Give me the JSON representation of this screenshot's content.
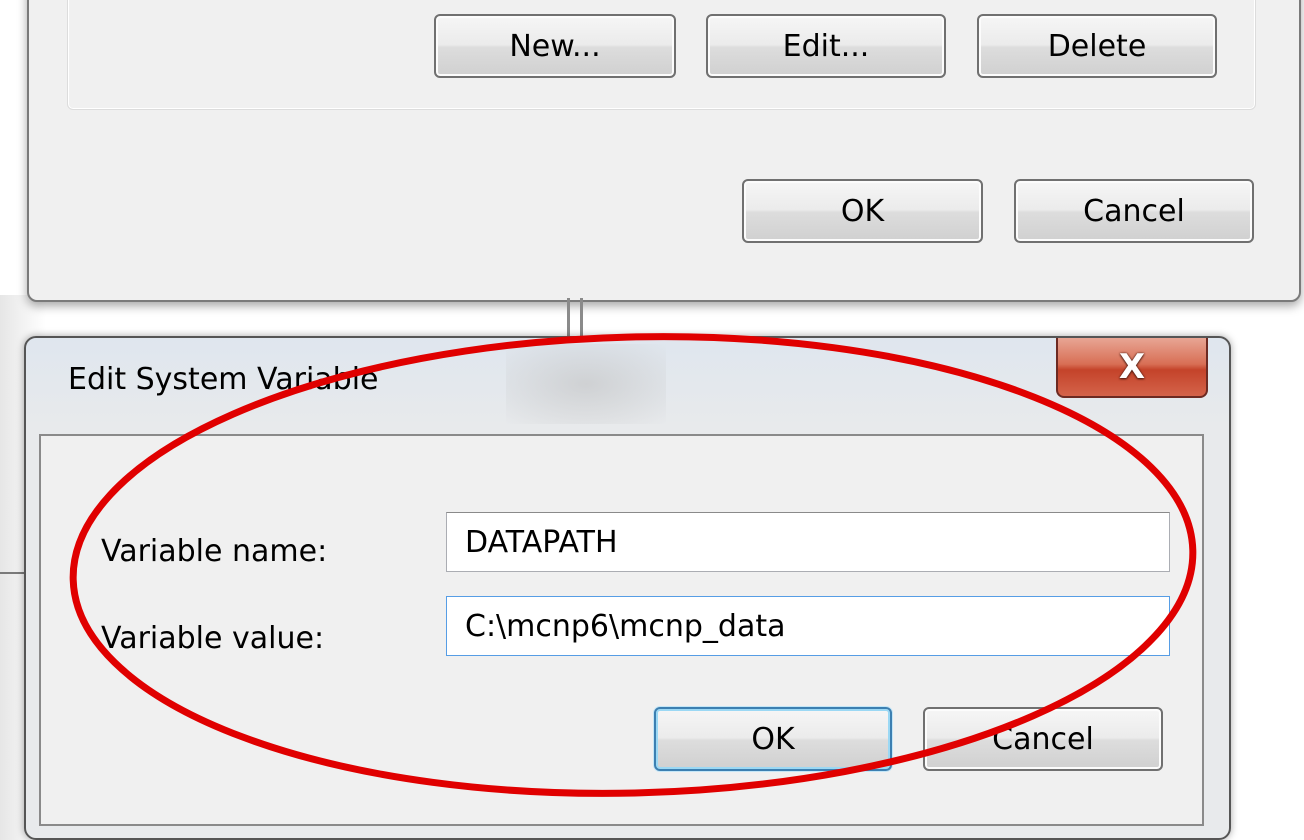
{
  "background_window": {
    "buttons": {
      "new_label": "New...",
      "edit_label": "Edit...",
      "delete_label": "Delete",
      "ok_label": "OK",
      "cancel_label": "Cancel"
    }
  },
  "dialog": {
    "title": "Edit System Variable",
    "close_label": "X",
    "fields": {
      "name_label": "Variable name:",
      "name_value": "DATAPATH",
      "value_label": "Variable value:",
      "value_value": "C:\\mcnp6\\mcnp_data"
    },
    "buttons": {
      "ok_label": "OK",
      "cancel_label": "Cancel"
    }
  },
  "annotation": {
    "shape": "ellipse",
    "color": "#e00000"
  },
  "colors": {
    "close_button": "#c4432a",
    "focus_border": "#569de5",
    "default_button_border": "#3c7fb1"
  }
}
